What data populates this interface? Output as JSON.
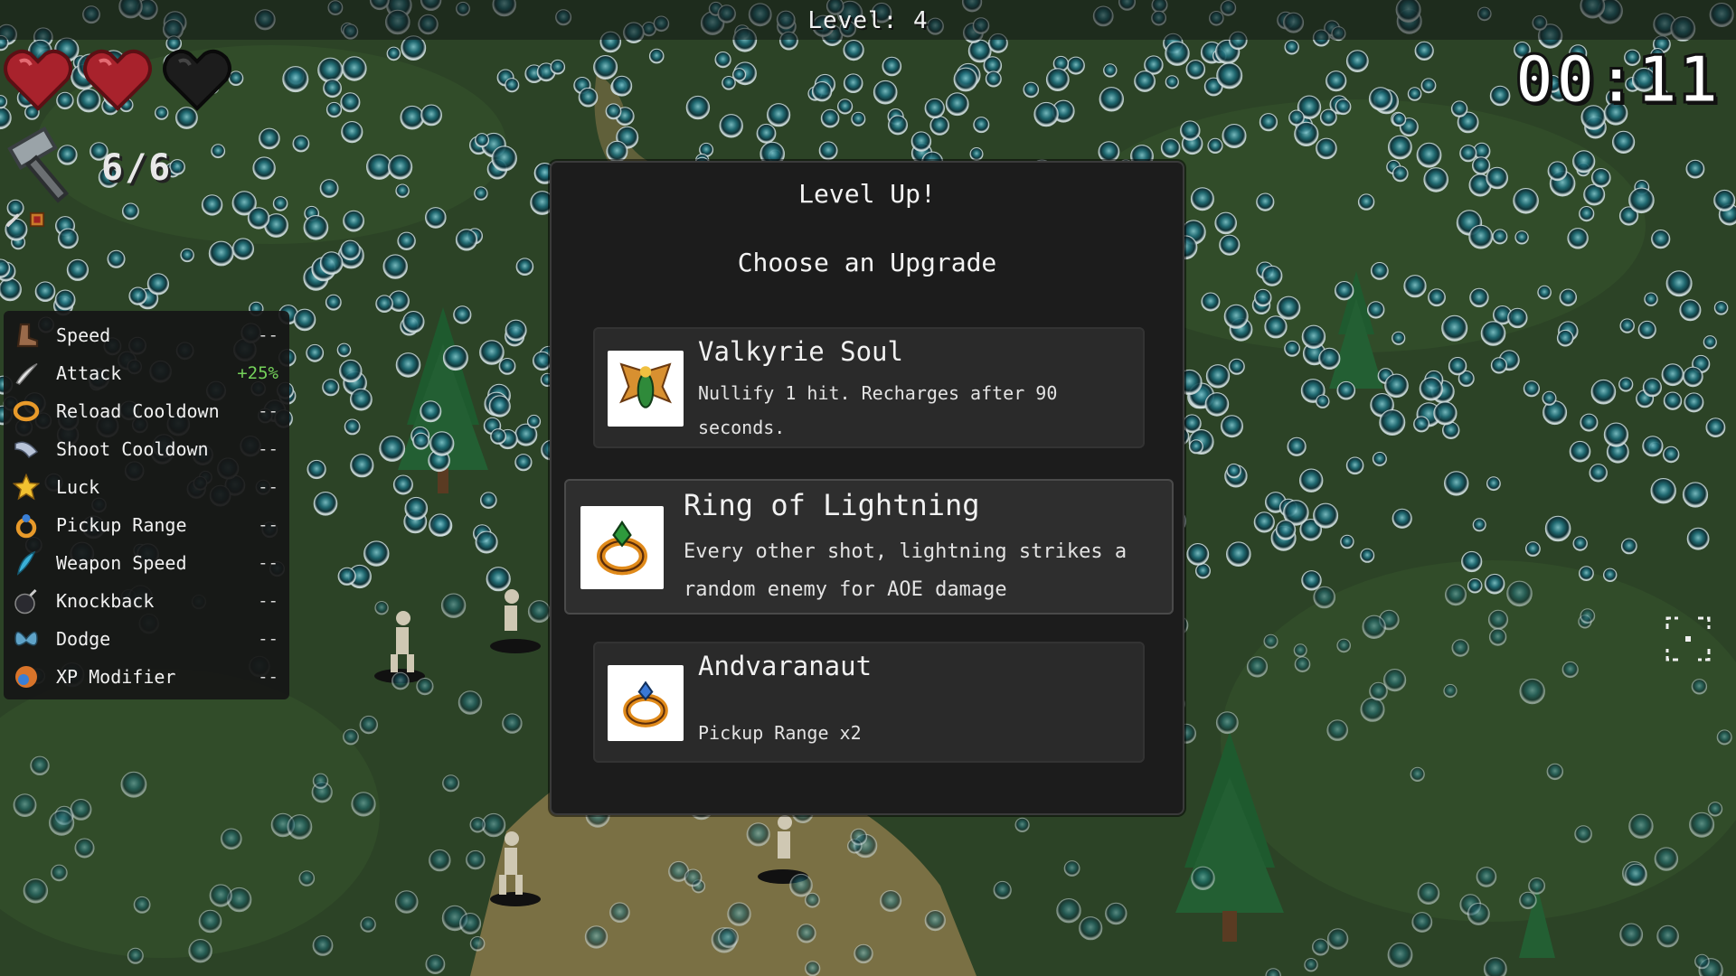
{
  "hud": {
    "level_label": "Level: 4",
    "timer": "00:11",
    "ammo_count": "6/6",
    "hearts": [
      {
        "state": "full",
        "color": "#a8222c"
      },
      {
        "state": "full",
        "color": "#a8222c"
      },
      {
        "state": "empty",
        "color": "#1c1c1c"
      }
    ]
  },
  "stats": [
    {
      "label": "Speed",
      "value": "--",
      "icon": "boot-icon"
    },
    {
      "label": "Attack",
      "value": "+25%",
      "icon": "claw-icon",
      "positive": true
    },
    {
      "label": "Reload Cooldown",
      "value": "--",
      "icon": "ring-icon"
    },
    {
      "label": "Shoot Cooldown",
      "value": "--",
      "icon": "wing-icon"
    },
    {
      "label": "Luck",
      "value": "--",
      "icon": "star-icon"
    },
    {
      "label": "Pickup Range",
      "value": "--",
      "icon": "amulet-icon"
    },
    {
      "label": "Weapon Speed",
      "value": "--",
      "icon": "feather-icon"
    },
    {
      "label": "Knockback",
      "value": "--",
      "icon": "bomb-icon"
    },
    {
      "label": "Dodge",
      "value": "--",
      "icon": "butterfly-icon"
    },
    {
      "label": "XP Modifier",
      "value": "--",
      "icon": "orb-icon"
    }
  ],
  "level_up": {
    "title": "Level Up!",
    "subtitle": "Choose an Upgrade",
    "options": [
      {
        "name": "Valkyrie Soul",
        "description": "Nullify 1 hit. Recharges after 90 seconds.",
        "icon": "valkyrie-soul-icon",
        "selected": false
      },
      {
        "name": "Ring of Lightning",
        "description": "Every other shot, lightning strikes a random enemy for AOE damage",
        "icon": "ring-of-lightning-icon",
        "selected": true
      },
      {
        "name": "Andvaranaut",
        "description": "Pickup Range x2",
        "icon": "andvaranaut-icon",
        "selected": false
      }
    ]
  },
  "colors": {
    "panel_bg": "#1c1c1c",
    "card_bg": "#2a2a2a",
    "positive_stat": "#74d15a",
    "grass": "#2c4326"
  }
}
